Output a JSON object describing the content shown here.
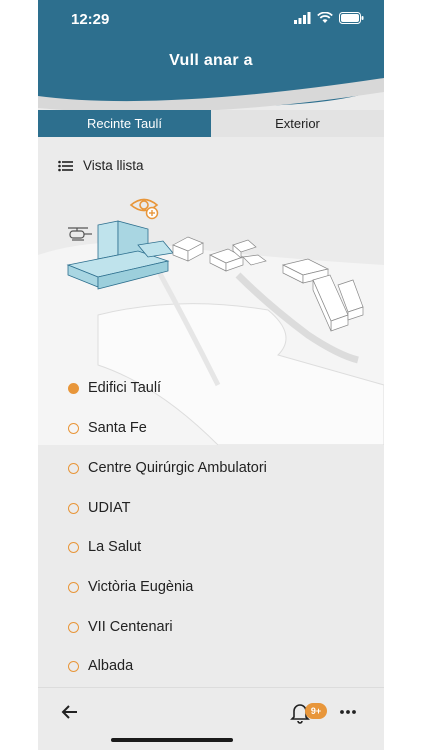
{
  "status_bar": {
    "time": "12:29"
  },
  "header": {
    "title": "Vull anar a"
  },
  "tabs": [
    {
      "label": "Recinte Taulí",
      "active": true
    },
    {
      "label": "Exterior",
      "active": false
    }
  ],
  "view_toggle": {
    "label": "Vista llista",
    "icon": "list-icon"
  },
  "destinations": [
    {
      "label": "Edifici Taulí",
      "selected": true
    },
    {
      "label": "Santa Fe",
      "selected": false
    },
    {
      "label": "Centre Quirúrgic Ambulatori",
      "selected": false
    },
    {
      "label": "UDIAT",
      "selected": false
    },
    {
      "label": "La Salut",
      "selected": false
    },
    {
      "label": "Victòria Eugènia",
      "selected": false
    },
    {
      "label": "VII Centenari",
      "selected": false
    },
    {
      "label": "Albada",
      "selected": false
    }
  ],
  "bottom_bar": {
    "notification_badge": "9+"
  },
  "colors": {
    "header": "#2d6f8e",
    "accent": "#e8963a",
    "building_highlight": "#bfe3ec"
  }
}
